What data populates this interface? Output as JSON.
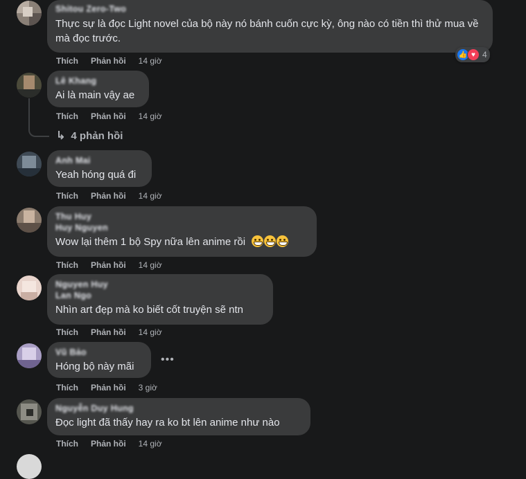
{
  "actions": {
    "like": "Thích",
    "reply": "Phản hồi"
  },
  "comments": [
    {
      "author": "Shitou Zero-Two",
      "text": "Thực sự là đọc Light novel của bộ này nó bánh cuốn cực kỳ, ông nào có tiền thì thử mua về mà đọc trước.",
      "time": "14 giờ",
      "reactions": {
        "icons": [
          "like-icon",
          "love-icon"
        ],
        "count": "4"
      }
    },
    {
      "author": "Lê Khang",
      "text": "Ai là main vậy ae",
      "time": "14 giờ",
      "replies": "4 phản hồi"
    },
    {
      "author": "Anh Mai",
      "text": "Yeah hóng quá đi",
      "time": "14 giờ"
    },
    {
      "author": "Thu Huy",
      "author2": "Huy Nguyen",
      "text": "Wow lại thêm 1 bộ Spy nữa lên anime rồi",
      "time": "14 giờ"
    },
    {
      "author": "Nguyen Huy",
      "author2": "Lan Ngo",
      "text": "Nhìn art đẹp mà ko biết cốt truyện sẽ ntn",
      "time": "14 giờ"
    },
    {
      "author": "Vũ Bảo",
      "text": "Hóng bộ này mãi",
      "time": "3 giờ"
    },
    {
      "author": "Nguyễn Duy Hung",
      "text": "Đọc light đã thấy hay ra ko bt lên anime như nào",
      "time": "14 giờ"
    }
  ],
  "colors": {
    "background": "#18191a",
    "bubble": "#3a3b3c",
    "text": "#e4e6eb",
    "muted": "#b0b3b8",
    "like": "#1877f2",
    "love": "#f33e58"
  }
}
